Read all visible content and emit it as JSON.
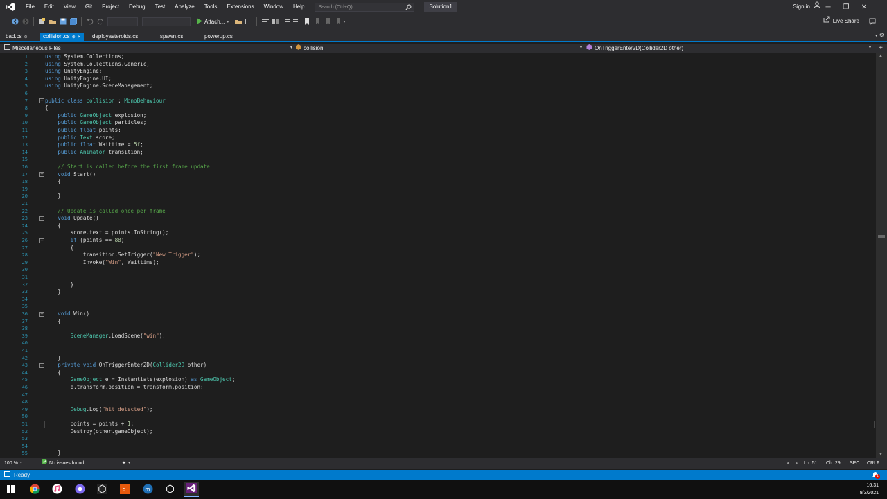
{
  "menu": {
    "items": [
      "File",
      "Edit",
      "View",
      "Git",
      "Project",
      "Debug",
      "Test",
      "Analyze",
      "Tools",
      "Extensions",
      "Window",
      "Help"
    ],
    "search_placeholder": "Search (Ctrl+Q)",
    "solution": "Solution1",
    "signin": "Sign in"
  },
  "toolbar": {
    "attach_label": "Attach...",
    "liveshare_label": "Live Share"
  },
  "tabs": [
    {
      "label": "bad.cs",
      "active": false
    },
    {
      "label": "collision.cs",
      "active": true
    },
    {
      "label": "deployasteroids.cs",
      "active": false
    },
    {
      "label": "spawn.cs",
      "active": false
    },
    {
      "label": "powerup.cs",
      "active": false
    }
  ],
  "navbar": {
    "project": "Miscellaneous Files",
    "class": "collision",
    "member": "OnTriggerEnter2D(Collider2D other)"
  },
  "editor": {
    "current_line": 51,
    "lines": [
      "using System.Collections;",
      "using System.Collections.Generic;",
      "using UnityEngine;",
      "using UnityEngine.UI;",
      "using UnityEngine.SceneManagement;",
      "",
      "public class collision : MonoBehaviour",
      "{",
      "    public GameObject explosion;",
      "    public GameObject particles;",
      "    public float points;",
      "    public Text score;",
      "    public float Waittime = 5f;",
      "    public Animator transition;",
      "",
      "    // Start is called before the first frame update",
      "    void Start()",
      "    {",
      "",
      "    }",
      "",
      "    // Update is called once per frame",
      "    void Update()",
      "    {",
      "        score.text = points.ToString();",
      "        if (points == 88)",
      "        {",
      "            transition.SetTrigger(\"New Trigger\");",
      "            Invoke(\"Win\", Waittime);",
      "",
      "",
      "        }",
      "    }",
      "",
      "",
      "    void Win()",
      "    {",
      "",
      "        SceneManager.LoadScene(\"win\");",
      "",
      "",
      "    }",
      "    private void OnTriggerEnter2D(Collider2D other)",
      "    {",
      "        GameObject e = Instantiate(explosion) as GameObject;",
      "        e.transform.position = transform.position;",
      "",
      "",
      "        Debug.Log(\"hit detected\");",
      "",
      "        points = points + 1;",
      "        Destroy(other.gameObject);",
      "",
      "",
      "    }"
    ]
  },
  "editor_status": {
    "zoom": "100 %",
    "issues": "No issues found",
    "ln": "Ln: 51",
    "ch": "Ch: 29",
    "spc": "SPC",
    "crlf": "CRLF"
  },
  "status": {
    "ready": "Ready",
    "notif_count": "1"
  },
  "taskbar": {
    "time": "16:31",
    "date": "9/3/2021"
  },
  "colors": {
    "accent": "#007acc",
    "keyword": "#569cd6",
    "type": "#4ec9b0",
    "string": "#d69d85",
    "comment": "#57a64a",
    "line_number": "#2b91af"
  }
}
